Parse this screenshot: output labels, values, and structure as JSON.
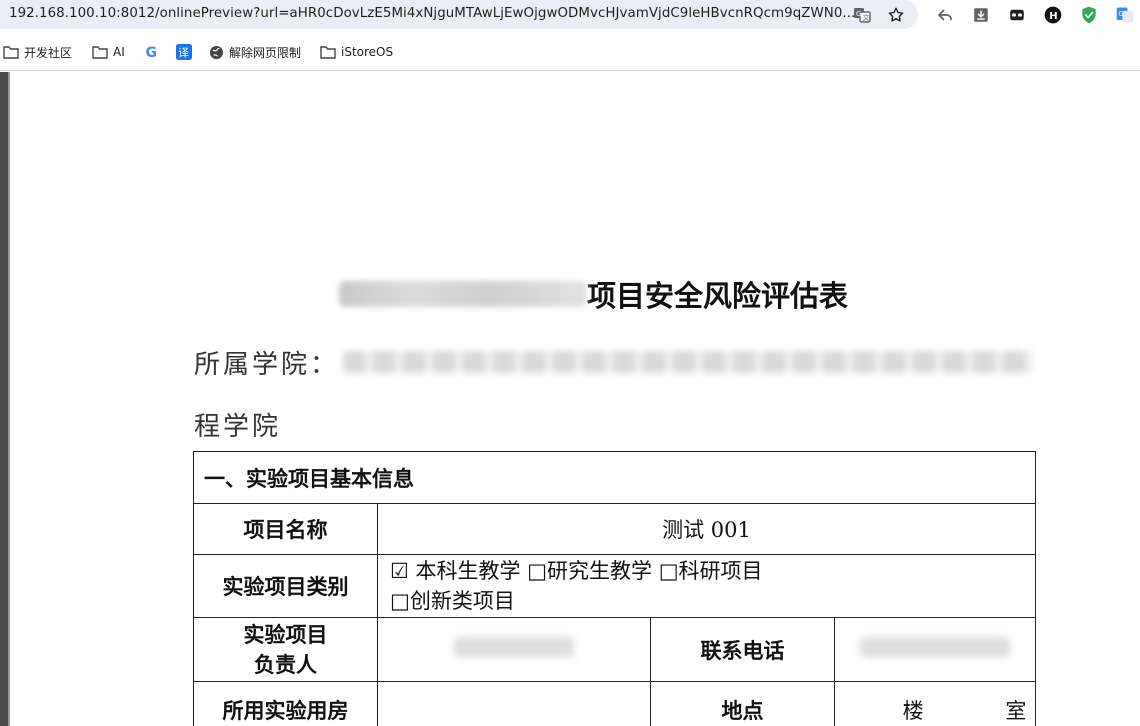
{
  "browser": {
    "url": "192.168.100.10:8012/onlinePreview?url=aHR0cDovLzE5Mi4xNjguMTAwLjEwOjgwODMvcHJvamVjdC9leHBvcnRQcm9qZWN0...",
    "bookmarks": [
      {
        "label": "开发社区",
        "icon": "folder-icon"
      },
      {
        "label": "AI",
        "icon": "folder-icon"
      },
      {
        "label": "",
        "icon": "google-icon"
      },
      {
        "label": "",
        "icon": "translate-icon"
      },
      {
        "label": "解除网页限制",
        "icon": "globe-icon"
      },
      {
        "label": "iStoreOS",
        "icon": "folder-icon"
      }
    ],
    "icons": {
      "google_g": "G",
      "translate_glyph": "译",
      "extension_h": "H"
    }
  },
  "document": {
    "title_suffix": "项目安全风险评估表",
    "college_label": "所属学院：",
    "college_line2": "程学院",
    "section1_title": "一、实验项目基本信息",
    "rows": {
      "project_name_label": "项目名称",
      "project_name_value": "测试 001",
      "project_type_label": "实验项目类别",
      "project_type_line1": "☑ 本科生教学 □研究生教学 □科研项目",
      "project_type_line2": "□创新类项目",
      "leader_label_1": "实验项目",
      "leader_label_2": "负责人",
      "phone_label": "联系电话",
      "room_label": "所用实验用房",
      "location_label": "地点",
      "location_building": "楼",
      "location_room": "室"
    }
  },
  "colors": {
    "url_bar": "#e9eef6",
    "google_blue": "#4285f4",
    "translate_blue": "#1a73e8",
    "shield_green": "#34a853"
  }
}
